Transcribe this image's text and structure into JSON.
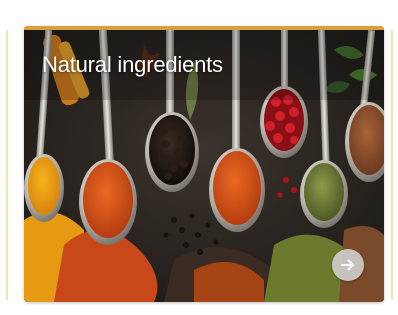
{
  "card": {
    "title": "Natural ingredients",
    "accent_color": "#d9a03a",
    "image_subject": "spices-in-spoons",
    "next_button_icon": "arrow-right-icon"
  }
}
